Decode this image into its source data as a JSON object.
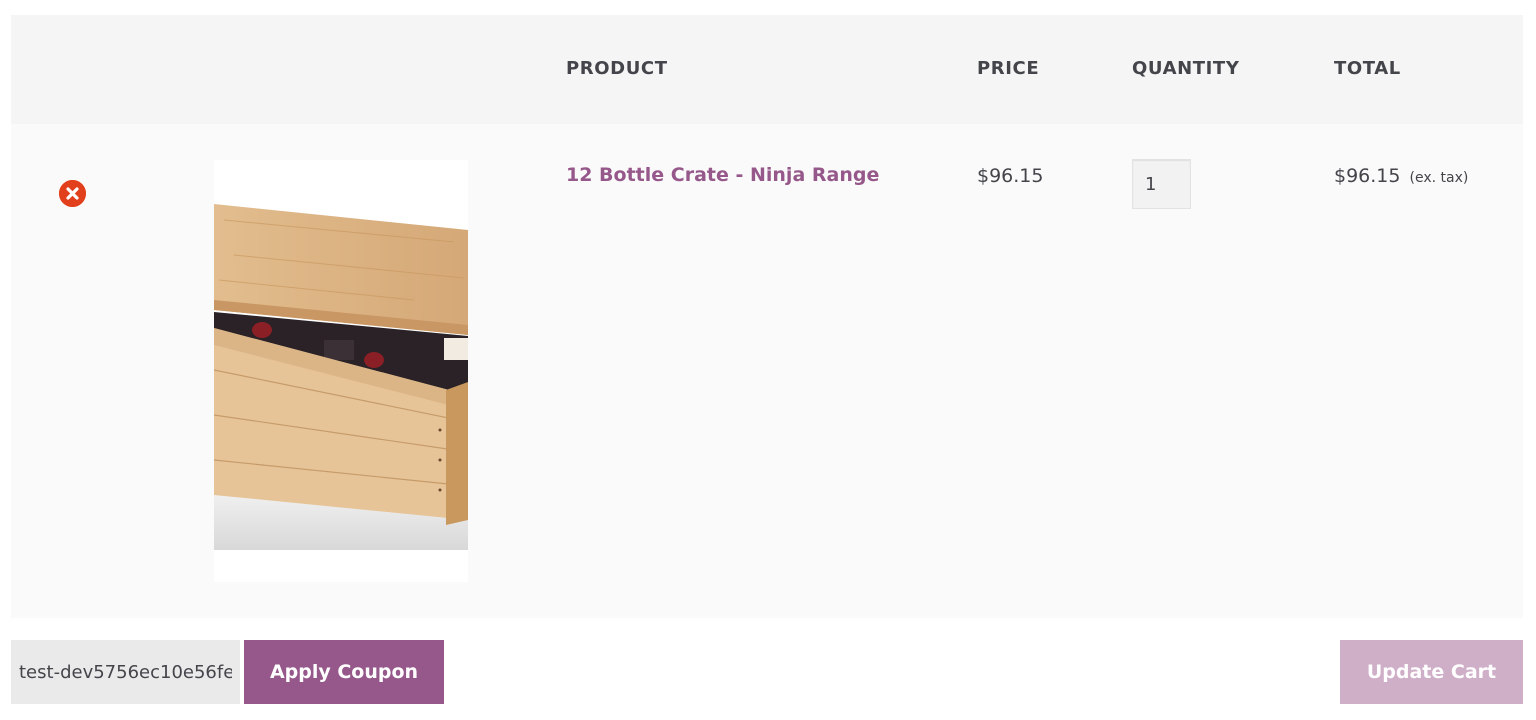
{
  "table": {
    "headers": {
      "product": "PRODUCT",
      "price": "PRICE",
      "quantity": "QUANTITY",
      "total": "TOTAL"
    },
    "items": [
      {
        "name": "12 Bottle Crate - Ninja Range",
        "price": "$96.15",
        "quantity": "1",
        "total": "$96.15",
        "tax_note": "(ex. tax)",
        "remove_icon": "remove-x-icon",
        "thumbnail": "wooden-wine-crate-image"
      }
    ]
  },
  "actions": {
    "coupon_value": "test-dev5756ec10e56fe",
    "apply_coupon_label": "Apply Coupon",
    "update_cart_label": "Update Cart"
  },
  "colors": {
    "accent": "#96588a",
    "accent_disabled": "#cfaec8",
    "remove": "#e2401c",
    "text": "#43454b",
    "header_bg": "#f5f5f5",
    "row_bg": "#fafafa"
  }
}
